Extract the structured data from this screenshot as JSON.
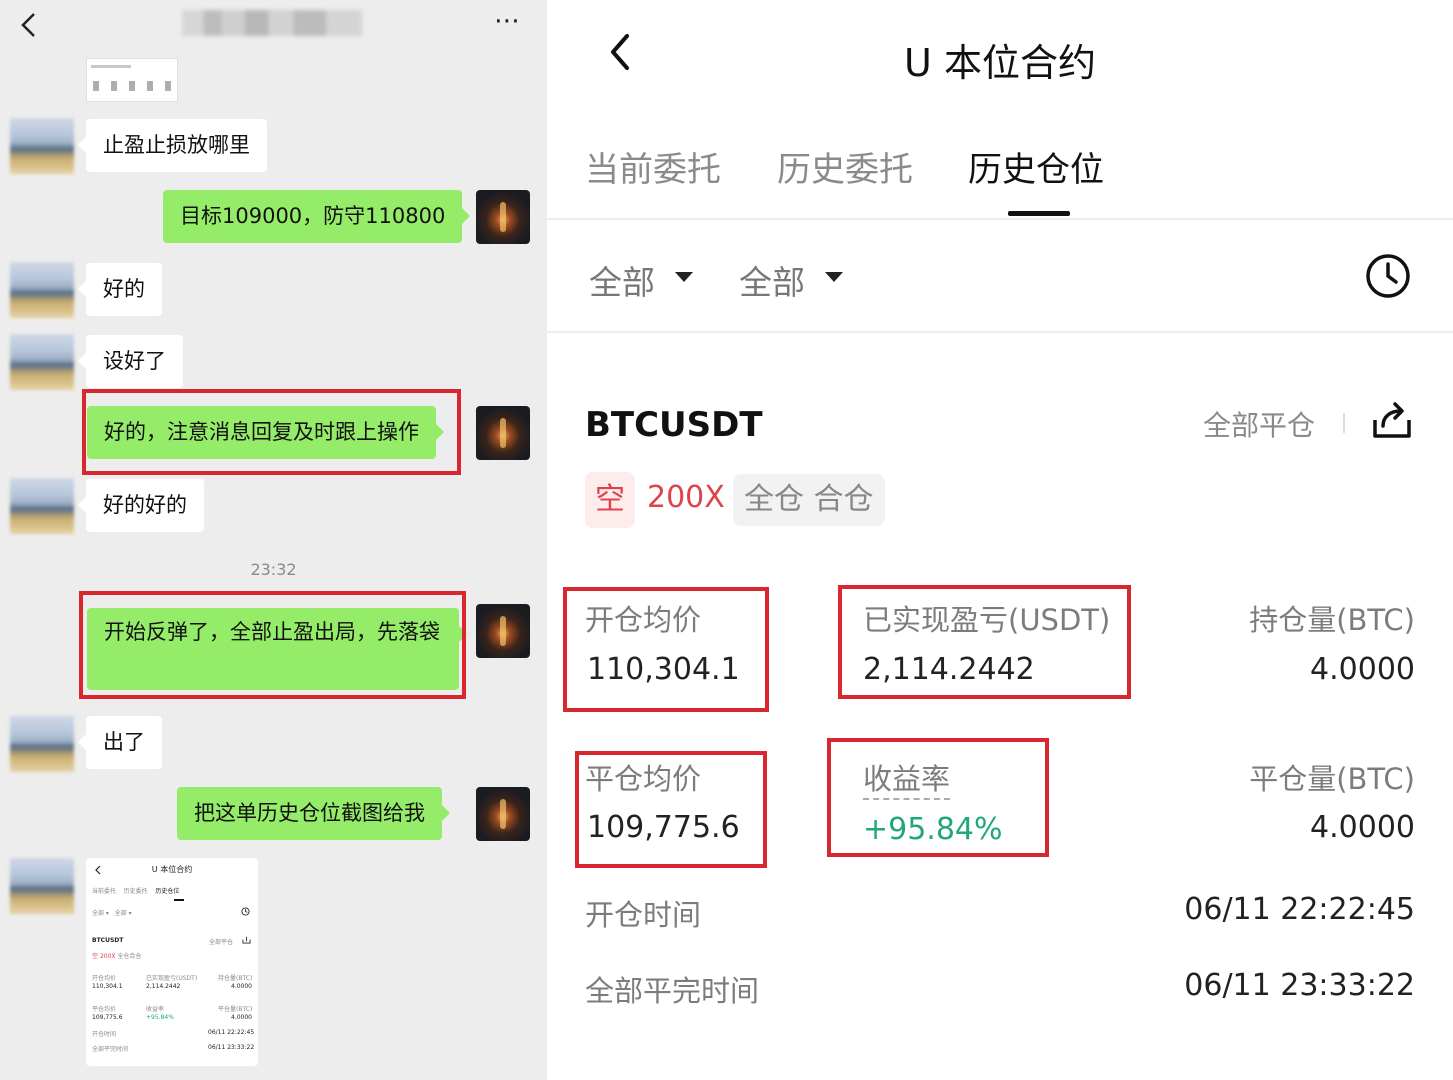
{
  "chat": {
    "more_icon": "⋯",
    "messages": [
      {
        "side": "in",
        "text": "止盈止损放哪里"
      },
      {
        "side": "out",
        "text": "目标109000，防守110800"
      },
      {
        "side": "in",
        "text": "好的"
      },
      {
        "side": "in",
        "text": "设好了"
      },
      {
        "side": "out",
        "text": "好的，注意消息回复及时跟上操作"
      },
      {
        "side": "in",
        "text": "好的好的"
      },
      {
        "side": "out",
        "text": "开始反弹了，全部止盈出局，先落袋"
      },
      {
        "side": "in",
        "text": "出了"
      },
      {
        "side": "out",
        "text": "把这单历史仓位截图给我"
      }
    ],
    "timestamp": "23:32",
    "mini_screenshot": {
      "title": "U 本位合约",
      "tabs": [
        "当前委托",
        "历史委托",
        "历史仓位"
      ],
      "filters": [
        "全部 ▾",
        "全部 ▾"
      ],
      "symbol": "BTCUSDT",
      "close_all": "全部平仓",
      "side": "空",
      "leverage": "200X",
      "mode": "全仓合仓",
      "open_avg_label": "开仓均价",
      "pnl_label": "已实现盈亏(USDT)",
      "pos_label": "持仓量(BTC)",
      "open_avg": "110,304.1",
      "pnl": "2,114.2442",
      "pos": "4.0000",
      "close_avg_label": "平仓均价",
      "roi_label": "收益率",
      "close_qty_label": "平仓量(BTC)",
      "close_avg": "109,775.6",
      "roi": "+95.84%",
      "close_qty": "4.0000",
      "open_time_label": "开仓时间",
      "open_time": "06/11 22:22:45",
      "close_time_label": "全部平完时间",
      "close_time": "06/11 23:33:22"
    }
  },
  "app": {
    "title": "U 本位合约",
    "tabs": [
      {
        "label": "当前委托",
        "active": false
      },
      {
        "label": "历史委托",
        "active": false
      },
      {
        "label": "历史仓位",
        "active": true
      }
    ],
    "filters": [
      "全部",
      "全部"
    ],
    "icons": {
      "back": "chevron-left-icon",
      "history": "clock-icon",
      "share": "share-icon",
      "dropdown": "caret-down-icon"
    },
    "position": {
      "symbol": "BTCUSDT",
      "close_all_label": "全部平仓",
      "side": "空",
      "leverage": "200X",
      "margin_mode": "全仓 合仓",
      "open_avg_price_label": "开仓均价",
      "open_avg_price": "110,304.1",
      "realized_pnl_label": "已实现盈亏(USDT)",
      "realized_pnl": "2,114.2442",
      "position_size_label": "持仓量(BTC)",
      "position_size": "4.0000",
      "close_avg_price_label": "平仓均价",
      "close_avg_price": "109,775.6",
      "roi_label": "收益率",
      "roi": "+95.84%",
      "close_size_label": "平仓量(BTC)",
      "close_size": "4.0000",
      "open_time_label": "开仓时间",
      "open_time": "06/11 22:22:45",
      "close_time_label": "全部平完时间",
      "close_time": "06/11 23:33:22"
    },
    "colors": {
      "short": "#e0424b",
      "profit": "#21a77a",
      "highlight_box": "#d9272f"
    }
  }
}
